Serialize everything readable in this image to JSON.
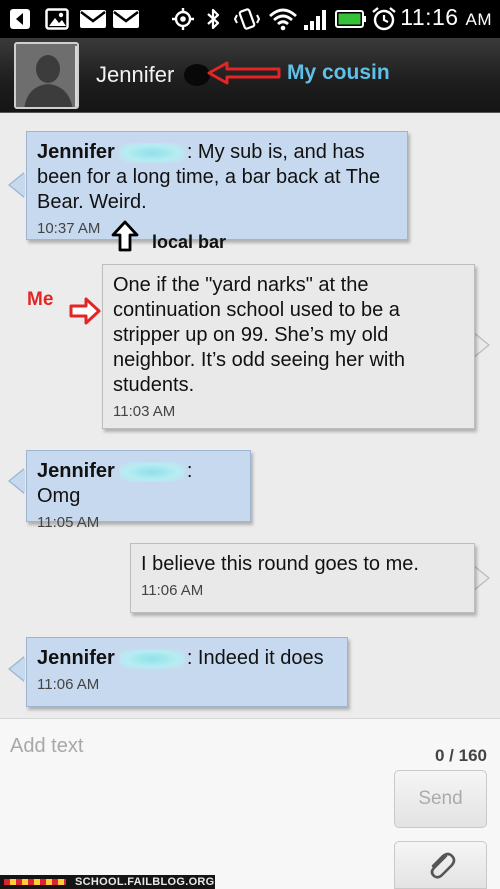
{
  "status_bar": {
    "icons": [
      "back-icon",
      "image-icon",
      "mail-icon",
      "mail-icon",
      "gps-icon",
      "bluetooth-icon",
      "vibrate-icon",
      "wifi-icon",
      "signal-icon",
      "battery-icon",
      "alarm-icon"
    ],
    "time": "11:16",
    "ampm": "AM"
  },
  "header": {
    "contact_name": "Jennifer",
    "annotation": "My cousin",
    "annotation_color": "#5fc0e8"
  },
  "messages": [
    {
      "direction": "in",
      "sender": "Jennifer",
      "text": ": My sub is, and has been for a long time, a bar back at The Bear. Weird.",
      "time": "10:37 AM"
    },
    {
      "direction": "out",
      "text": "One if the \"yard narks\" at the continuation school used to be a stripper up on 99. She’s my old neighbor. It’s odd seeing her with students.",
      "time": "11:03 AM"
    },
    {
      "direction": "in",
      "sender": "Jennifer",
      "text": ": Omg",
      "time": "11:05 AM"
    },
    {
      "direction": "out",
      "text": "I believe this round goes to me.",
      "time": "11:06 AM"
    },
    {
      "direction": "in",
      "sender": "Jennifer",
      "text": ": Indeed it does",
      "time": "11:06 AM"
    }
  ],
  "annotations": {
    "local_bar": "local bar",
    "me": "Me",
    "me_color": "#e32525"
  },
  "composer": {
    "placeholder": "Add text",
    "char_count": "0 / 160",
    "send_label": "Send"
  },
  "watermark": {
    "text": "SCHOOL.FAILBLOG.ORG"
  },
  "colors": {
    "incoming_bubble": "#c7d9ef",
    "outgoing_bubble": "#e9e9e9",
    "status_bar": "#000000"
  }
}
